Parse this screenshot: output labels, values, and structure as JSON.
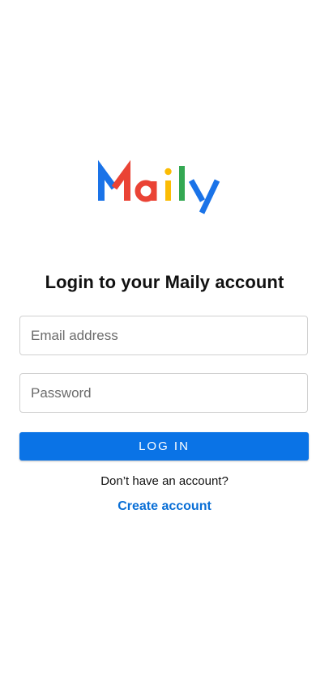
{
  "brand": {
    "logo_text": "Maily",
    "colors": {
      "blue": "#1a73e8",
      "red": "#ea4335",
      "yellow": "#fbbc04",
      "green": "#34a853"
    }
  },
  "login": {
    "title": "Login to your Maily account",
    "email_placeholder": "Email address",
    "password_placeholder": "Password",
    "submit_label": "LOG IN",
    "no_account_text": "Don’t have an account?",
    "create_account_label": "Create account"
  },
  "theme": {
    "primary": "#0a73e6",
    "link": "#0a6fd6"
  }
}
